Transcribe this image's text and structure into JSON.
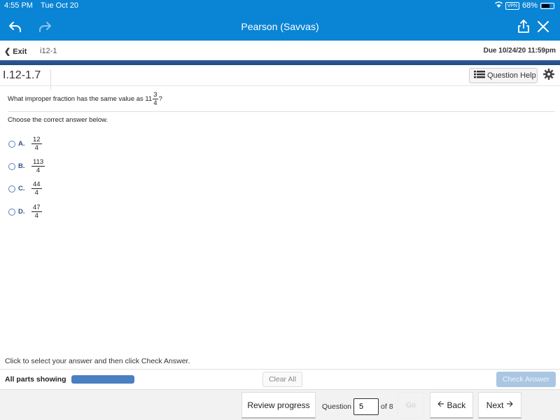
{
  "status_bar": {
    "time": "4:55 PM",
    "date": "Tue Oct 20",
    "vpn": "VPN",
    "battery": "68%",
    "battery_level": 0.68
  },
  "top_bar": {
    "title": "Pearson (Savvas)",
    "icons": [
      "undo-icon",
      "redo-icon",
      "share-icon",
      "close-icon"
    ]
  },
  "sub_bar": {
    "exit_label": "Exit",
    "assignment": "i12-1",
    "due": "Due 10/24/20 11:59pm"
  },
  "question_header": {
    "id": "I.12-1.7",
    "help_label": "Question Help"
  },
  "question": {
    "prefix": "What improper fraction has the same value as 11",
    "mixed_num": "3",
    "mixed_den": "4",
    "suffix": "?",
    "instruction": "Choose the correct answer below."
  },
  "options": [
    {
      "label": "A.",
      "num": "12",
      "den": "4"
    },
    {
      "label": "B.",
      "num": "113",
      "den": "4"
    },
    {
      "label": "C.",
      "num": "44",
      "den": "4"
    },
    {
      "label": "D.",
      "num": "47",
      "den": "4"
    }
  ],
  "bottom": {
    "instruction": "Click to select your answer and then click Check Answer.",
    "parts_label": "All parts showing",
    "parts_progress": 1.0,
    "clear_all": "Clear All",
    "check_answer": "Check Answer"
  },
  "footer": {
    "review": "Review progress",
    "question_label": "Question",
    "question_value": "5",
    "of_label": "of 8",
    "go": "Go",
    "back": "Back",
    "next": "Next"
  }
}
